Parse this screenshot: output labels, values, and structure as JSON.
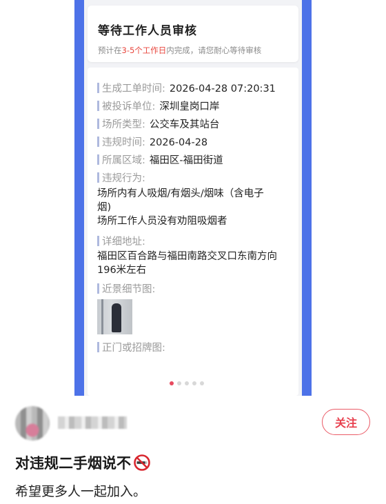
{
  "status": {
    "title": "等待工作人员审核",
    "sub_prefix": "预计在",
    "sub_highlight": "3-5个工作日",
    "sub_suffix": "内完成，请您耐心等待审核"
  },
  "details": {
    "created_label": "生成工单时间:",
    "created_value": "2026-04-28 07:20:31",
    "complained_label": "被投诉单位:",
    "complained_value": "深圳皇岗口岸",
    "venue_type_label": "场所类型:",
    "venue_type_value": "公交车及其站台",
    "violation_time_label": "违规时间:",
    "violation_time_value": "2026-04-28",
    "district_label": "所属区域:",
    "district_value": "福田区-福田街道",
    "behavior_label": "违规行为:",
    "behavior_line1": "场所内有人吸烟/有烟头/烟味（含电子",
    "behavior_line2": "烟)",
    "behavior_line3": "场所工作人员没有劝阻吸烟者",
    "address_label": "详细地址:",
    "address_line1": "福田区百合路与福田南路交叉口东南方向",
    "address_line2": "196米左右",
    "closeup_label": "近景细节图:",
    "entrance_label": "正门或招牌图:"
  },
  "carousel": {
    "count": 5,
    "active": 0
  },
  "post": {
    "follow_label": "关注",
    "title": "对违规二手烟说不",
    "title_icon": "no-smoking-icon",
    "body": "希望更多人一起加入。"
  },
  "colors": {
    "accent_red": "#e8404e",
    "panel_blue": "#4d72e8"
  }
}
